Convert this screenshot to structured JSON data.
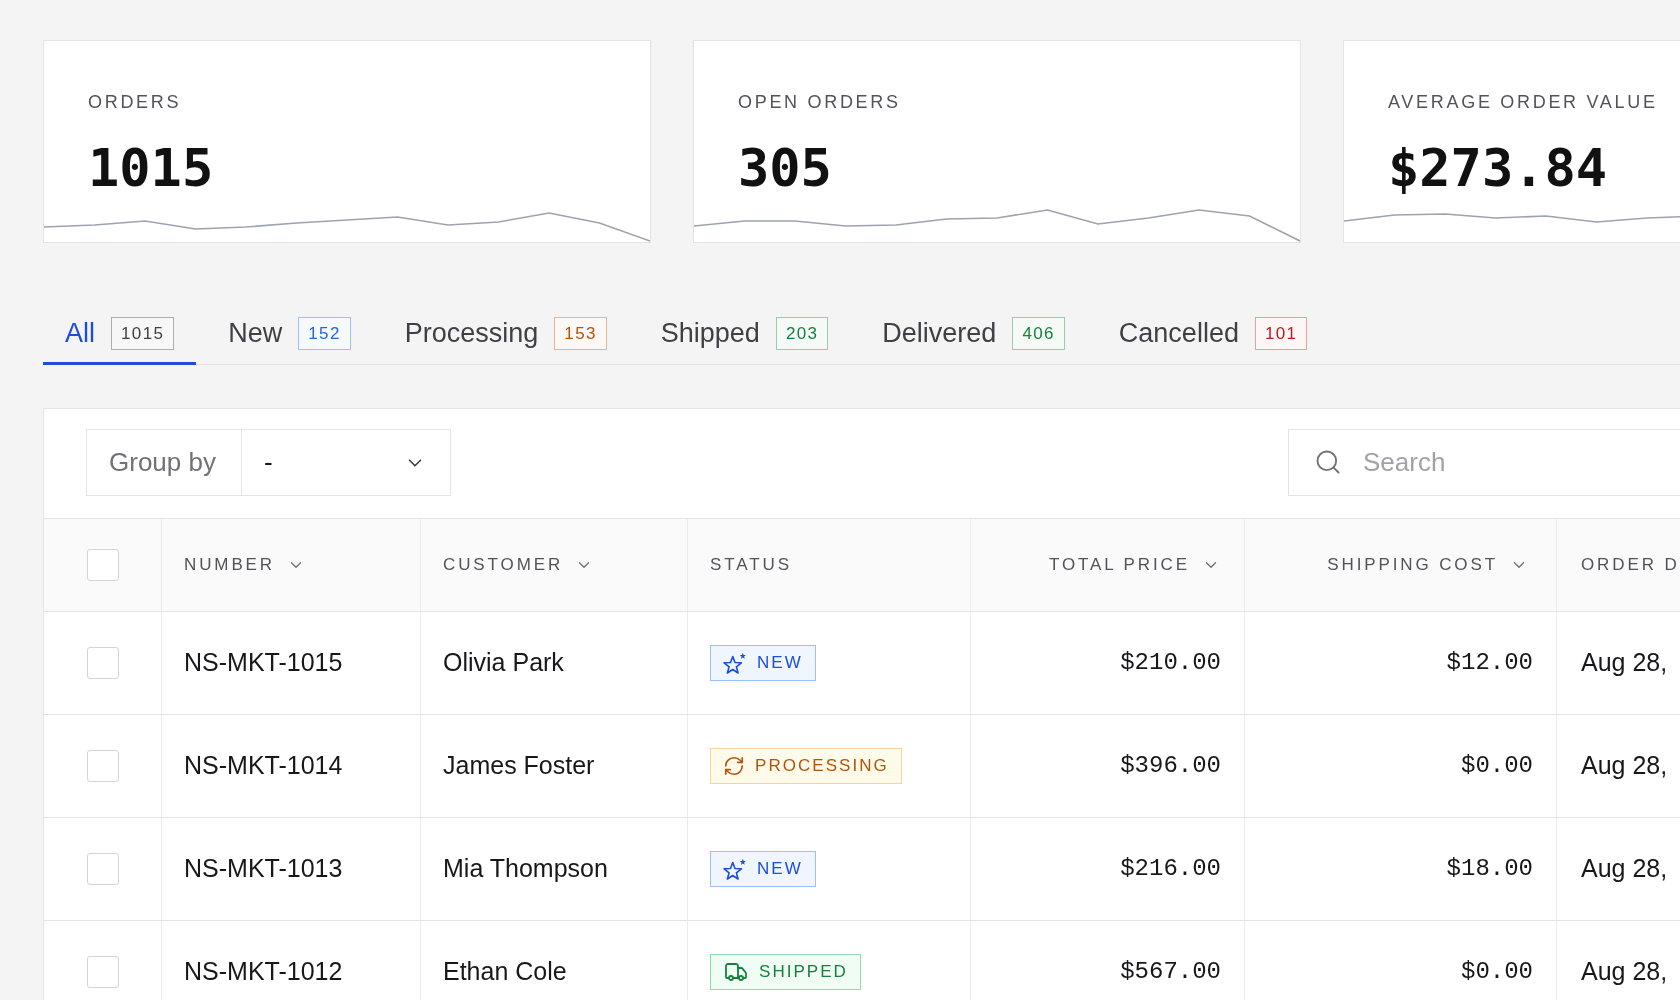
{
  "stats": [
    {
      "label": "ORDERS",
      "value": "1015"
    },
    {
      "label": "OPEN ORDERS",
      "value": "305"
    },
    {
      "label": "AVERAGE ORDER VALUE",
      "value": "$273.84"
    }
  ],
  "tabs": [
    {
      "label": "All",
      "count": "1015",
      "color": "#3f3f46",
      "selected": true
    },
    {
      "label": "New",
      "count": "152",
      "color": "#2563eb",
      "selected": false
    },
    {
      "label": "Processing",
      "count": "153",
      "color": "#b45309",
      "selected": false
    },
    {
      "label": "Shipped",
      "count": "203",
      "color": "#15803d",
      "selected": false
    },
    {
      "label": "Delivered",
      "count": "406",
      "color": "#15803d",
      "selected": false
    },
    {
      "label": "Cancelled",
      "count": "101",
      "color": "#b91c1c",
      "selected": false
    }
  ],
  "toolbar": {
    "group_by": {
      "label": "Group by",
      "value": "-"
    },
    "search": {
      "placeholder": "Search"
    }
  },
  "table": {
    "select_all": {
      "checked": false
    },
    "columns": [
      {
        "label": "NUMBER",
        "sortable": true
      },
      {
        "label": "CUSTOMER",
        "sortable": true
      },
      {
        "label": "STATUS",
        "sortable": false
      },
      {
        "label": "TOTAL PRICE",
        "sortable": true
      },
      {
        "label": "SHIPPING COST",
        "sortable": true
      },
      {
        "label": "ORDER D"
      }
    ],
    "rows": [
      {
        "checked": false,
        "number": "NS-MKT-1015",
        "customer": "Olivia Park",
        "status": {
          "label": "NEW",
          "kind": "new"
        },
        "total_price": "$210.00",
        "shipping_cost": "$12.00",
        "order_date": "Aug 28,"
      },
      {
        "checked": false,
        "number": "NS-MKT-1014",
        "customer": "James Foster",
        "status": {
          "label": "PROCESSING",
          "kind": "processing"
        },
        "total_price": "$396.00",
        "shipping_cost": "$0.00",
        "order_date": "Aug 28,"
      },
      {
        "checked": false,
        "number": "NS-MKT-1013",
        "customer": "Mia Thompson",
        "status": {
          "label": "NEW",
          "kind": "new"
        },
        "total_price": "$216.00",
        "shipping_cost": "$18.00",
        "order_date": "Aug 28,"
      },
      {
        "checked": false,
        "number": "NS-MKT-1012",
        "customer": "Ethan Cole",
        "status": {
          "label": "SHIPPED",
          "kind": "shipped"
        },
        "total_price": "$567.00",
        "shipping_cost": "$0.00",
        "order_date": "Aug 28,"
      }
    ]
  }
}
